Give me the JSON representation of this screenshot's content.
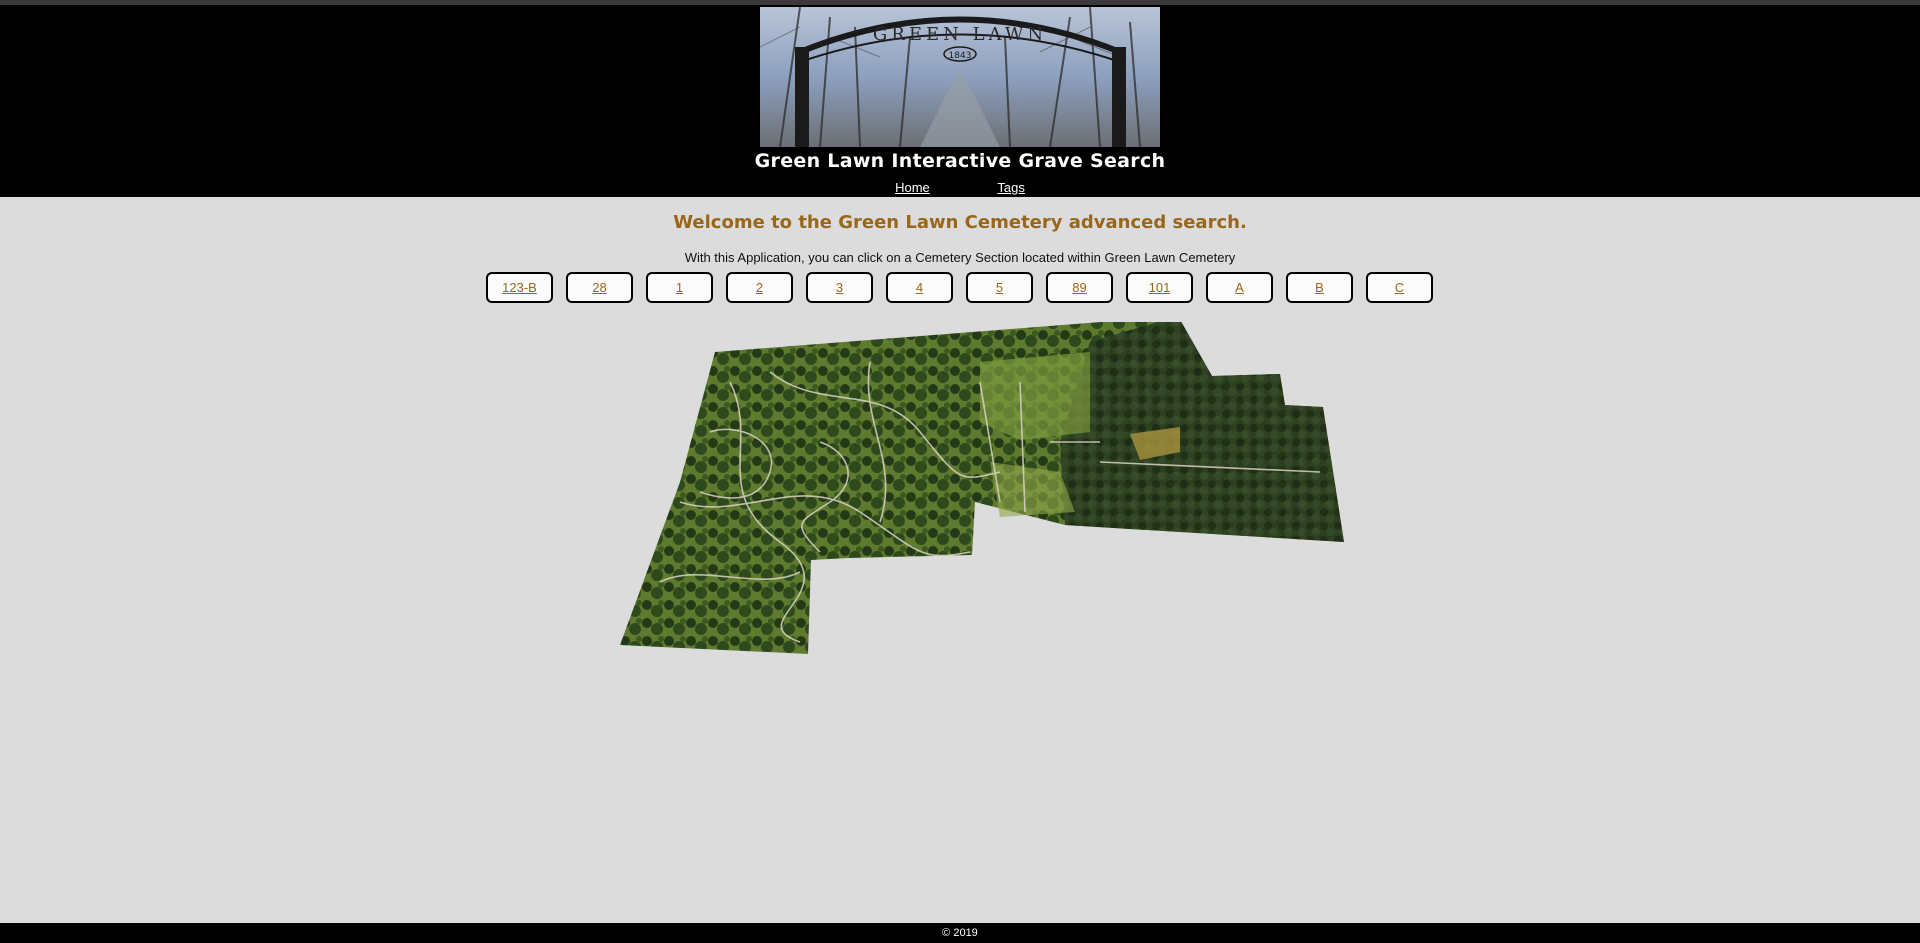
{
  "header": {
    "banner_sign_text": "GREEN LAWN",
    "banner_sign_year": "1843",
    "title": "Green Lawn Interactive Grave Search"
  },
  "nav": [
    {
      "label": "Home"
    },
    {
      "label": "Tags"
    }
  ],
  "main": {
    "welcome": "Welcome to the Green Lawn Cemetery advanced search.",
    "intro": "With this Application, you can click on a Cemetery Section located within Green Lawn Cemetery",
    "sections": [
      "123-B",
      "28",
      "1",
      "2",
      "3",
      "4",
      "5",
      "89",
      "101",
      "A",
      "B",
      "C"
    ]
  },
  "footer": {
    "copyright": "© 2019"
  },
  "colors": {
    "accent": "#99661a",
    "header_bg": "#000000",
    "page_bg": "#dcdcdc"
  }
}
